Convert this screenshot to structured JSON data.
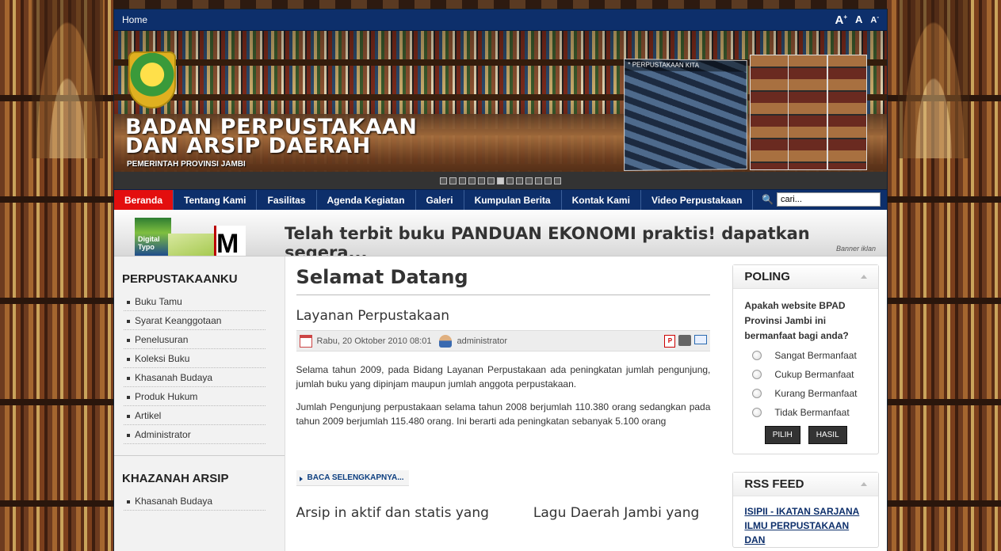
{
  "topbar": {
    "home_label": "Home",
    "font_big": "A",
    "font_normal": "A",
    "font_small": "A"
  },
  "header": {
    "title_line1": "BADAN PERPUSTAKAAN",
    "title_line2": "DAN ARSIP DAERAH",
    "subtitle": "PEMERINTAH PROVINSI JAMBI",
    "slide_label": "* PERPUSTAKAAN KITA",
    "slide_count": 13,
    "active_slide": 7
  },
  "nav": {
    "items": [
      {
        "label": "Beranda",
        "active": true
      },
      {
        "label": "Tentang Kami",
        "active": false
      },
      {
        "label": "Fasilitas",
        "active": false
      },
      {
        "label": "Agenda Kegiatan",
        "active": false
      },
      {
        "label": "Galeri",
        "active": false
      },
      {
        "label": "Kumpulan Berita",
        "active": false
      },
      {
        "label": "Kontak Kami",
        "active": false
      },
      {
        "label": "Video Perpustakaan",
        "active": false
      }
    ],
    "search_value": "cari..."
  },
  "ad": {
    "book_label": "Digital Typo",
    "book_letter": "M",
    "text": "Telah terbit buku PANDUAN EKONOMI praktis! dapatkan segera...",
    "caption": "Banner iklan"
  },
  "left": {
    "module1_title": "PERPUSTAKAANKU",
    "module1_items": [
      "Buku Tamu",
      "Syarat Keanggotaan",
      "Penelusuran",
      "Koleksi Buku",
      "Khasanah Budaya",
      "Produk Hukum",
      "Artikel",
      "Administrator"
    ],
    "module2_title": "KHAZANAH ARSIP",
    "module2_items": [
      "Khasanah Budaya"
    ]
  },
  "main": {
    "page_title": "Selamat Datang",
    "article_title": "Layanan Perpustakaan",
    "date": "Rabu, 20 Oktober 2010 08:01",
    "author": "administrator",
    "paragraph1": "Selama tahun 2009,  pada Bidang Layanan Perpustakaan ada peningkatan jumlah pengunjung, jumlah buku yang dipinjam maupun jumlah anggota perpustakaan.",
    "paragraph2": "Jumlah Pengunjung perpustakaan selama tahun 2008 berjumlah 110.380 orang sedangkan pada tahun 2009 berjumlah 115.480 orang. Ini berarti ada peningkatan sebanyak 5.100 orang",
    "readmore": "BACA SELENGKAPNYA...",
    "sub1_title": "Arsip in aktif dan statis yang",
    "sub2_title": "Lagu Daerah Jambi yang"
  },
  "right": {
    "poll_title": "POLING",
    "poll_question": "Apakah website BPAD Provinsi Jambi ini bermanfaat bagi anda?",
    "poll_options": [
      "Sangat Bermanfaat",
      "Cukup Bermanfaat",
      "Kurang Bermanfaat",
      "Tidak Bermanfaat"
    ],
    "vote_label": "PILIH",
    "result_label": "HASIL",
    "rss_title": "RSS FEED",
    "rss_link": "ISIPII - IKATAN SARJANA ILMU PERPUSTAKAAN DAN"
  }
}
